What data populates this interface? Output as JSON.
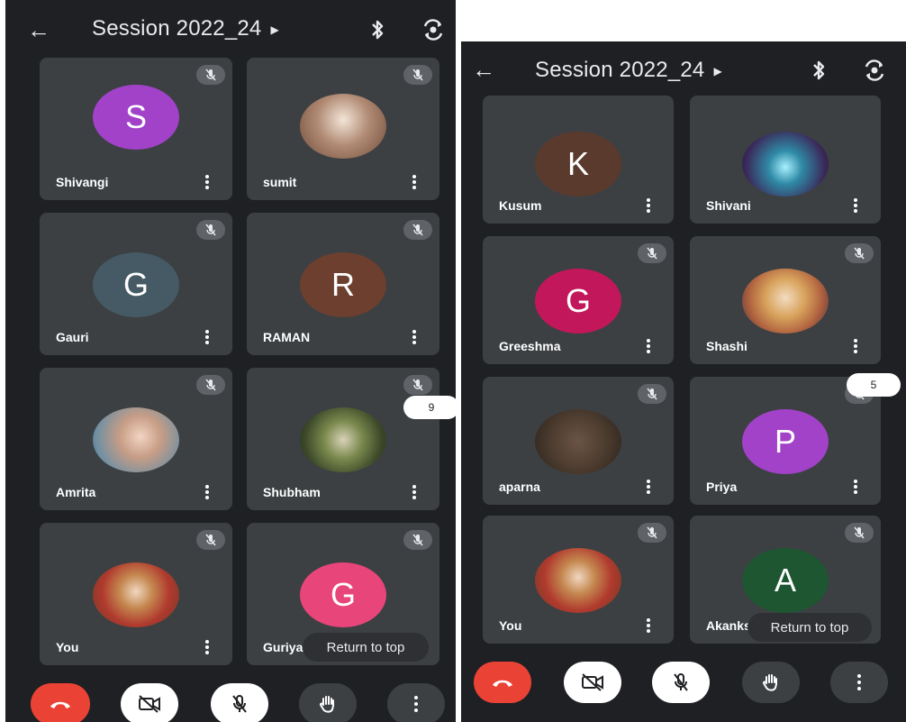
{
  "left": {
    "title": "Session 2022_24",
    "participants": [
      {
        "name": "Shivangi",
        "initial": "S",
        "color": "#a142c8",
        "muted": true
      },
      {
        "name": "sumit",
        "initial": "",
        "color": "#7b6b5e",
        "muted": true
      },
      {
        "name": "Gauri",
        "initial": "G",
        "color": "#455a64",
        "muted": true
      },
      {
        "name": "RAMAN",
        "initial": "R",
        "color": "#6d3f2f",
        "muted": true
      },
      {
        "name": "Amrita",
        "initial": "",
        "color": "#8fb3c9",
        "muted": true
      },
      {
        "name": "Shubham",
        "initial": "",
        "color": "#4b5e3a",
        "muted": true
      },
      {
        "name": "You",
        "initial": "",
        "color": "#b88a5a",
        "muted": true
      },
      {
        "name": "Guriya",
        "initial": "G",
        "color": "#e8457a",
        "muted": true
      }
    ],
    "scroll_badge": "9",
    "return_to_top": "Return to top"
  },
  "right": {
    "title": "Session 2022_24",
    "participants": [
      {
        "name": "Kusum",
        "initial": "K",
        "color": "#5b3a2e",
        "muted": false
      },
      {
        "name": "Shivani",
        "initial": "",
        "color": "#2f8aa6",
        "muted": false
      },
      {
        "name": "Greeshma",
        "initial": "G",
        "color": "#c2185b",
        "muted": true
      },
      {
        "name": "Shashi",
        "initial": "",
        "color": "#b0623f",
        "muted": true
      },
      {
        "name": "aparna",
        "initial": "",
        "color": "#4a3a2e",
        "muted": true
      },
      {
        "name": "Priya",
        "initial": "P",
        "color": "#a142c8",
        "muted": true
      },
      {
        "name": "You",
        "initial": "",
        "color": "#b88a5a",
        "muted": true
      },
      {
        "name": "Akanksha",
        "initial": "A",
        "color": "#1e5631",
        "muted": true
      }
    ],
    "scroll_badge": "5",
    "return_to_top": "Return to top"
  },
  "icons": {
    "back": "back-arrow-icon",
    "bluetooth": "bluetooth-icon",
    "switch_camera": "switch-camera-icon",
    "mic_off": "mic-off-icon",
    "more": "more-vert-icon",
    "end_call": "end-call-icon",
    "video_off": "video-off-icon",
    "raise_hand": "raise-hand-icon"
  },
  "colors": {
    "background": "#1f2024",
    "tile": "#3c4043",
    "end_call": "#ea4335"
  }
}
